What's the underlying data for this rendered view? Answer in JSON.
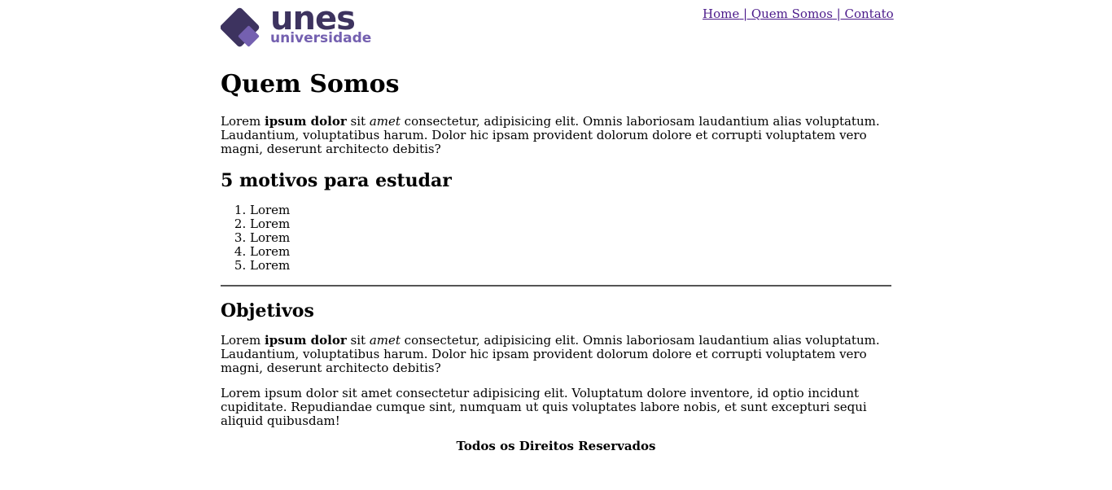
{
  "brand": {
    "name": "unes",
    "sub": "universidade",
    "primary_color": "#3d335f",
    "secondary_color": "#7460b0"
  },
  "nav": {
    "items": [
      {
        "label": "Home",
        "sep": " | "
      },
      {
        "label": "Quem Somos",
        "sep": " | "
      },
      {
        "label": "Contato",
        "sep": ""
      }
    ]
  },
  "main": {
    "title": "Quem Somos",
    "intro": {
      "t1": "Lorem ",
      "bold": "ipsum dolor",
      "t2": " sit ",
      "italic": "amet",
      "t3": " consectetur, adipisicing elit. Omnis laboriosam laudantium alias voluptatum. Laudantium, voluptatibus harum. Dolor hic ipsam provident dolorum dolore et corrupti voluptatem vero magni, deserunt architecto debitis?"
    },
    "motivos": {
      "heading": "5 motivos para estudar",
      "items": [
        "Lorem",
        "Lorem",
        "Lorem",
        "Lorem",
        "Lorem"
      ]
    },
    "objetivos": {
      "heading": "Objetivos",
      "p1": {
        "t1": "Lorem ",
        "bold": "ipsum dolor",
        "t2": " sit ",
        "italic": "amet",
        "t3": " consectetur, adipisicing elit. Omnis laboriosam laudantium alias voluptatum. Laudantium, voluptatibus harum. Dolor hic ipsam provident dolorum dolore et corrupti voluptatem vero magni, deserunt architecto debitis?"
      },
      "p2": "Lorem ipsum dolor sit amet consectetur adipisicing elit. Voluptatum dolore inventore, id optio incidunt cupiditate. Repudiandae cumque sint, numquam ut quis voluptates labore nobis, et sunt excepturi sequi aliquid quibusdam!"
    }
  },
  "footer": {
    "text": "Todos os Direitos Reservados"
  }
}
